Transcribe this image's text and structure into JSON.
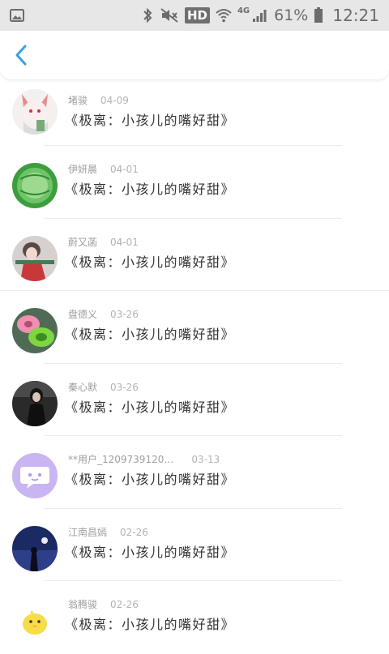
{
  "status_bar": {
    "hd_label": "HD",
    "signal_label": "4G",
    "battery_percent": "61%",
    "time": "12:21",
    "icons": [
      "image-icon",
      "bluetooth-icon",
      "mute-icon",
      "hd-icon",
      "wifi-icon",
      "signal-icon",
      "battery-icon"
    ]
  },
  "header": {
    "back_icon": "chevron-left-icon",
    "accent_color": "#3a9fe6"
  },
  "comments": [
    {
      "name": "堵骏",
      "date": "04-09",
      "text": "《极离：小孩儿的嘴好甜》"
    },
    {
      "name": "伊妍晨",
      "date": "04-01",
      "text": "《极离：小孩儿的嘴好甜》"
    },
    {
      "name": "蔚又菡",
      "date": "04-01",
      "text": "《极离：小孩儿的嘴好甜》"
    },
    {
      "name": "盘德义",
      "date": "03-26",
      "text": "《极离：小孩儿的嘴好甜》"
    },
    {
      "name": "秦心默",
      "date": "03-26",
      "text": "《极离：小孩儿的嘴好甜》"
    },
    {
      "name": "**用户_1209739120…",
      "date": "03-13",
      "text": "《极离：小孩儿的嘴好甜》"
    },
    {
      "name": "江南昌嫣",
      "date": "02-26",
      "text": "《极离：小孩儿的嘴好甜》"
    },
    {
      "name": "翁腾骏",
      "date": "02-26",
      "text": "《极离：小孩儿的嘴好甜》"
    }
  ]
}
